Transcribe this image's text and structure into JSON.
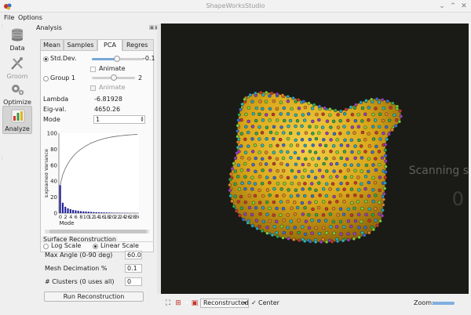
{
  "window": {
    "title": "ShapeWorksStudio"
  },
  "menu": {
    "file": "File",
    "options": "Options"
  },
  "leftbar": {
    "items": [
      {
        "label": "Data",
        "icon": "database-icon",
        "state": "normal"
      },
      {
        "label": "Groom",
        "icon": "groom-tools-icon",
        "state": "disabled"
      },
      {
        "label": "Optimize",
        "icon": "gears-icon",
        "state": "normal"
      },
      {
        "label": "Analyze",
        "icon": "analyze-chart-icon",
        "state": "active"
      }
    ]
  },
  "panel": {
    "title": "Analysis",
    "tabs": [
      {
        "label": "Mean",
        "active": false
      },
      {
        "label": "Samples",
        "active": false
      },
      {
        "label": "PCA",
        "active": true
      },
      {
        "label": "Regres",
        "active": false
      }
    ],
    "pca": {
      "std_dev_label": "Std.Dev.",
      "std_dev_value": "-0.1",
      "std_dev_slider_fraction": 0.48,
      "animate_1_label": "Animate",
      "group_label": "Group 1",
      "group_value": "2",
      "group_slider_fraction": 0.5,
      "animate_2_label": "Animate",
      "lambda_label": "Lambda",
      "lambda_value": "-6.81928",
      "eigval_label": "Eig-val.",
      "eigval_value": "4650.26",
      "mode_label": "Mode",
      "mode_value": "1",
      "log_scale_label": "Log Scale",
      "linear_scale_label": "Linear Scale",
      "scale_selected": "linear"
    }
  },
  "surface": {
    "title": "Surface Reconstruction",
    "max_angle_label": "Max Angle (0-90 deg)",
    "max_angle_value": "60.0",
    "mesh_decimation_label": "Mesh Decimation %",
    "mesh_decimation_value": "0.1",
    "clusters_label": "# Clusters (0 uses all)",
    "clusters_value": "0",
    "run_button": "Run Reconstruction"
  },
  "chart_data": {
    "type": "bar",
    "ylabel": "Explained Variance",
    "xlabel": "Mode",
    "ylim": [
      0,
      100
    ],
    "yticks": [
      "100",
      "80",
      "60",
      "40",
      "20",
      "0"
    ],
    "xticks": [
      "0",
      "2",
      "4",
      "6",
      "8",
      "10",
      "12",
      "14",
      "16",
      "18",
      "20",
      "22",
      "24",
      "26",
      "28",
      "30",
      "3"
    ],
    "bar_values": [
      35,
      13,
      8,
      6,
      5,
      4,
      3.5,
      3,
      2.5,
      2.2,
      2,
      1.8,
      1.6,
      1.4,
      1.2,
      1.1,
      1,
      0.9,
      0.8,
      0.7,
      0.6,
      0.5,
      0.5,
      0.4,
      0.4,
      0.3,
      0.3,
      0.2,
      0.2,
      0.2,
      0.1
    ],
    "cumulative_values": [
      35,
      48,
      56,
      62,
      67,
      71,
      74.5,
      77.5,
      80,
      82.2,
      84.2,
      86,
      87.6,
      89,
      90.2,
      91.3,
      92.3,
      93.2,
      94,
      94.7,
      95.3,
      95.8,
      96.3,
      96.7,
      97.1,
      97.4,
      97.7,
      97.9,
      98.1,
      98.3,
      98.4
    ],
    "bar_color": "#1f1f9a",
    "line_color": "#666666"
  },
  "viewer": {
    "background": "#1a1b16",
    "watermark_text": "Scanning s",
    "watermark_number": "0"
  },
  "bottombar": {
    "view_mode": "Reconstructed",
    "center_label": "Center",
    "center_checked": true,
    "zoom_label": "Zoom:"
  }
}
